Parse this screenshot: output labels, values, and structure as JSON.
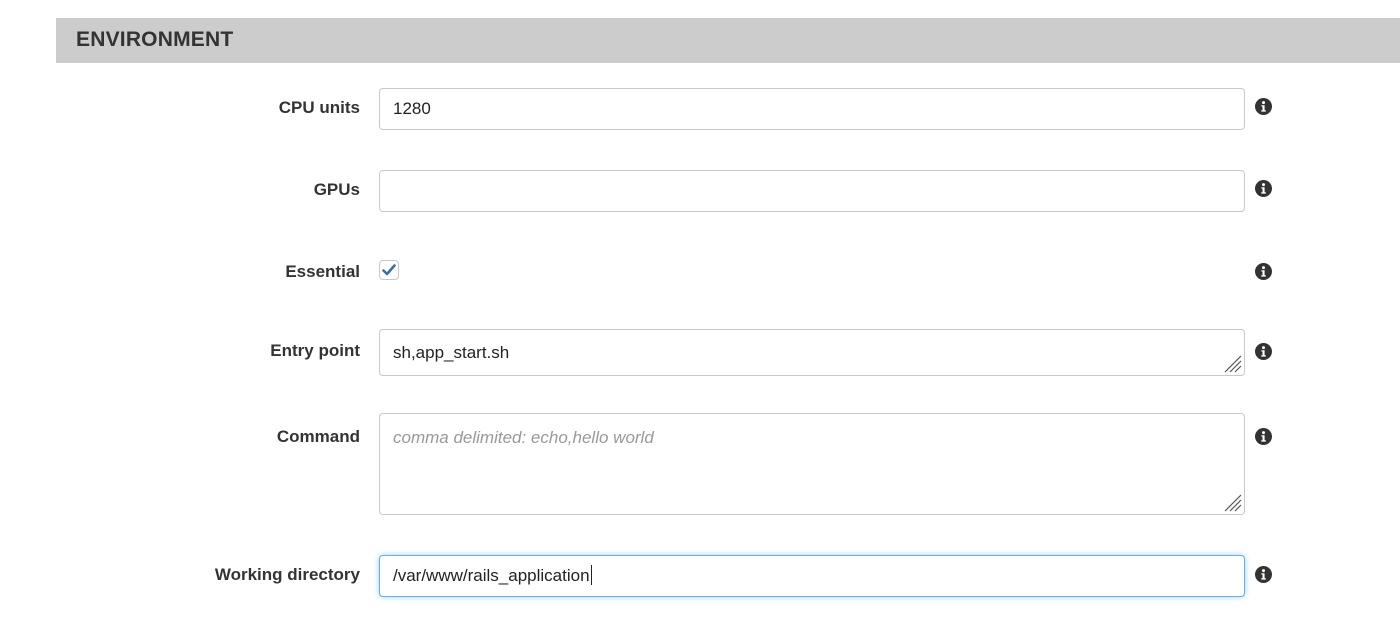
{
  "section": {
    "title": "ENVIRONMENT"
  },
  "fields": {
    "cpu_units": {
      "label": "CPU units",
      "value": "1280"
    },
    "gpus": {
      "label": "GPUs",
      "value": ""
    },
    "essential": {
      "label": "Essential",
      "checked": true
    },
    "entry_point": {
      "label": "Entry point",
      "value": "sh,app_start.sh"
    },
    "command": {
      "label": "Command",
      "value": "",
      "placeholder": "comma delimited: echo,hello world"
    },
    "working_directory": {
      "label": "Working directory",
      "value": "/var/www/rails_application"
    }
  },
  "icons": {
    "info": "info-icon",
    "checkmark": "checkmark-icon",
    "resize": "resize-handle-icon"
  },
  "colors": {
    "header_bg": "#cccccc",
    "focus_border": "#66afe9",
    "check_color": "#3c6e9c",
    "text": "#333333",
    "placeholder": "#999999"
  }
}
